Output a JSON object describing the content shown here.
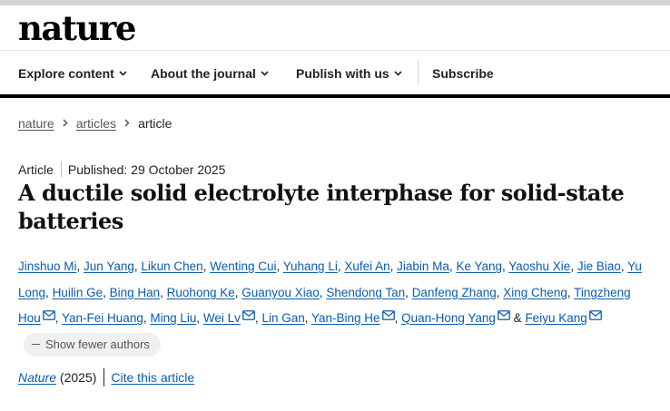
{
  "brand": {
    "logo_text": "nature"
  },
  "nav": {
    "items": [
      {
        "label": "Explore content",
        "has_menu": true
      },
      {
        "label": "About the journal",
        "has_menu": true
      },
      {
        "label": "Publish with us",
        "has_menu": true
      },
      {
        "label": "Subscribe",
        "has_menu": false
      }
    ]
  },
  "breadcrumb": {
    "items": [
      "nature",
      "articles"
    ],
    "current": "article"
  },
  "article": {
    "type": "Article",
    "published": "Published: 29 October 2025",
    "title": "A ductile solid electrolyte interphase for solid-state batteries",
    "authors": [
      {
        "name": "Jinshuo Mi",
        "mail": false
      },
      {
        "name": "Jun Yang",
        "mail": false
      },
      {
        "name": "Likun Chen",
        "mail": false
      },
      {
        "name": "Wenting Cui",
        "mail": false
      },
      {
        "name": "Yuhang Li",
        "mail": false
      },
      {
        "name": "Xufei An",
        "mail": false
      },
      {
        "name": "Jiabin Ma",
        "mail": false
      },
      {
        "name": "Ke Yang",
        "mail": false
      },
      {
        "name": "Yaoshu Xie",
        "mail": false
      },
      {
        "name": "Jie Biao",
        "mail": false
      },
      {
        "name": "Yu Long",
        "mail": false
      },
      {
        "name": "Huilin Ge",
        "mail": false
      },
      {
        "name": "Bing Han",
        "mail": false
      },
      {
        "name": "Ruohong Ke",
        "mail": false
      },
      {
        "name": "Guanyou Xiao",
        "mail": false
      },
      {
        "name": "Shendong Tan",
        "mail": false
      },
      {
        "name": "Danfeng Zhang",
        "mail": false
      },
      {
        "name": "Xing Cheng",
        "mail": false
      },
      {
        "name": "Tingzheng Hou",
        "mail": true
      },
      {
        "name": "Yan-Fei Huang",
        "mail": false
      },
      {
        "name": "Ming Liu",
        "mail": false
      },
      {
        "name": "Wei Lv",
        "mail": true
      },
      {
        "name": "Lin Gan",
        "mail": false
      },
      {
        "name": "Yan-Bing He",
        "mail": true
      },
      {
        "name": "Quan-Hong Yang",
        "mail": true
      },
      {
        "name": "Feiyu Kang",
        "mail": true
      }
    ],
    "final_separator": "&",
    "show_fewer_label": "Show fewer authors",
    "journal": "Nature",
    "year": "(2025)",
    "cite_label": "Cite this article"
  },
  "icons": {
    "mail": "mail-icon",
    "chevron_down": "chevron-down-icon",
    "chevron_right": "chevron-right-icon"
  },
  "colors": {
    "link": "#0b5cad",
    "rule": "#000000",
    "pill_bg": "#eef0f2"
  }
}
